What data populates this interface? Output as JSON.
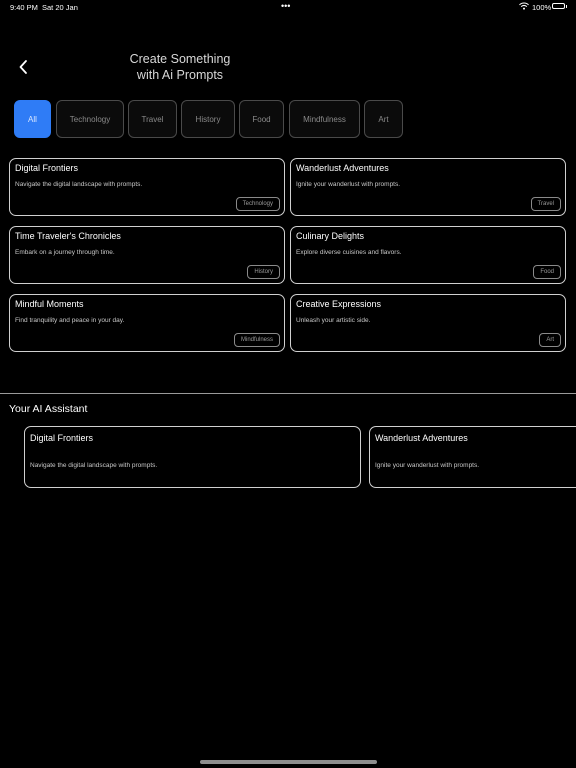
{
  "status_bar": {
    "time": "9:40 PM",
    "date": "Sat 20 Jan",
    "dots": "•••",
    "battery": "100%"
  },
  "header": {
    "title_line1": "Create Something",
    "title_line2": "with Ai Prompts"
  },
  "tabs": [
    {
      "label": "All",
      "active": true
    },
    {
      "label": "Technology"
    },
    {
      "label": "Travel"
    },
    {
      "label": "History"
    },
    {
      "label": "Food"
    },
    {
      "label": "Mindfulness"
    },
    {
      "label": "Art"
    }
  ],
  "prompt_cards": [
    {
      "title": "Digital Frontiers",
      "desc": "Navigate the digital landscape with prompts.",
      "tag": "Technology"
    },
    {
      "title": "Wanderlust Adventures",
      "desc": "Ignite your wanderlust with prompts.",
      "tag": "Travel"
    },
    {
      "title": "Time Traveler's Chronicles",
      "desc": "Embark on a journey through time.",
      "tag": "History"
    },
    {
      "title": "Culinary Delights",
      "desc": "Explore diverse cuisines and flavors.",
      "tag": "Food"
    },
    {
      "title": "Mindful Moments",
      "desc": "Find tranquility and peace in your day.",
      "tag": "Mindfulness"
    },
    {
      "title": "Creative Expressions",
      "desc": "Unleash your artistic side.",
      "tag": "Art"
    }
  ],
  "assistant": {
    "title": "Your AI Assistant",
    "cards": [
      {
        "title": "Digital Frontiers",
        "desc": "Navigate the digital landscape with prompts."
      },
      {
        "title": "Wanderlust Adventures",
        "desc": "Ignite your wanderlust with prompts."
      }
    ]
  },
  "colors": {
    "accent": "#2f7cf6",
    "background": "#000000"
  }
}
